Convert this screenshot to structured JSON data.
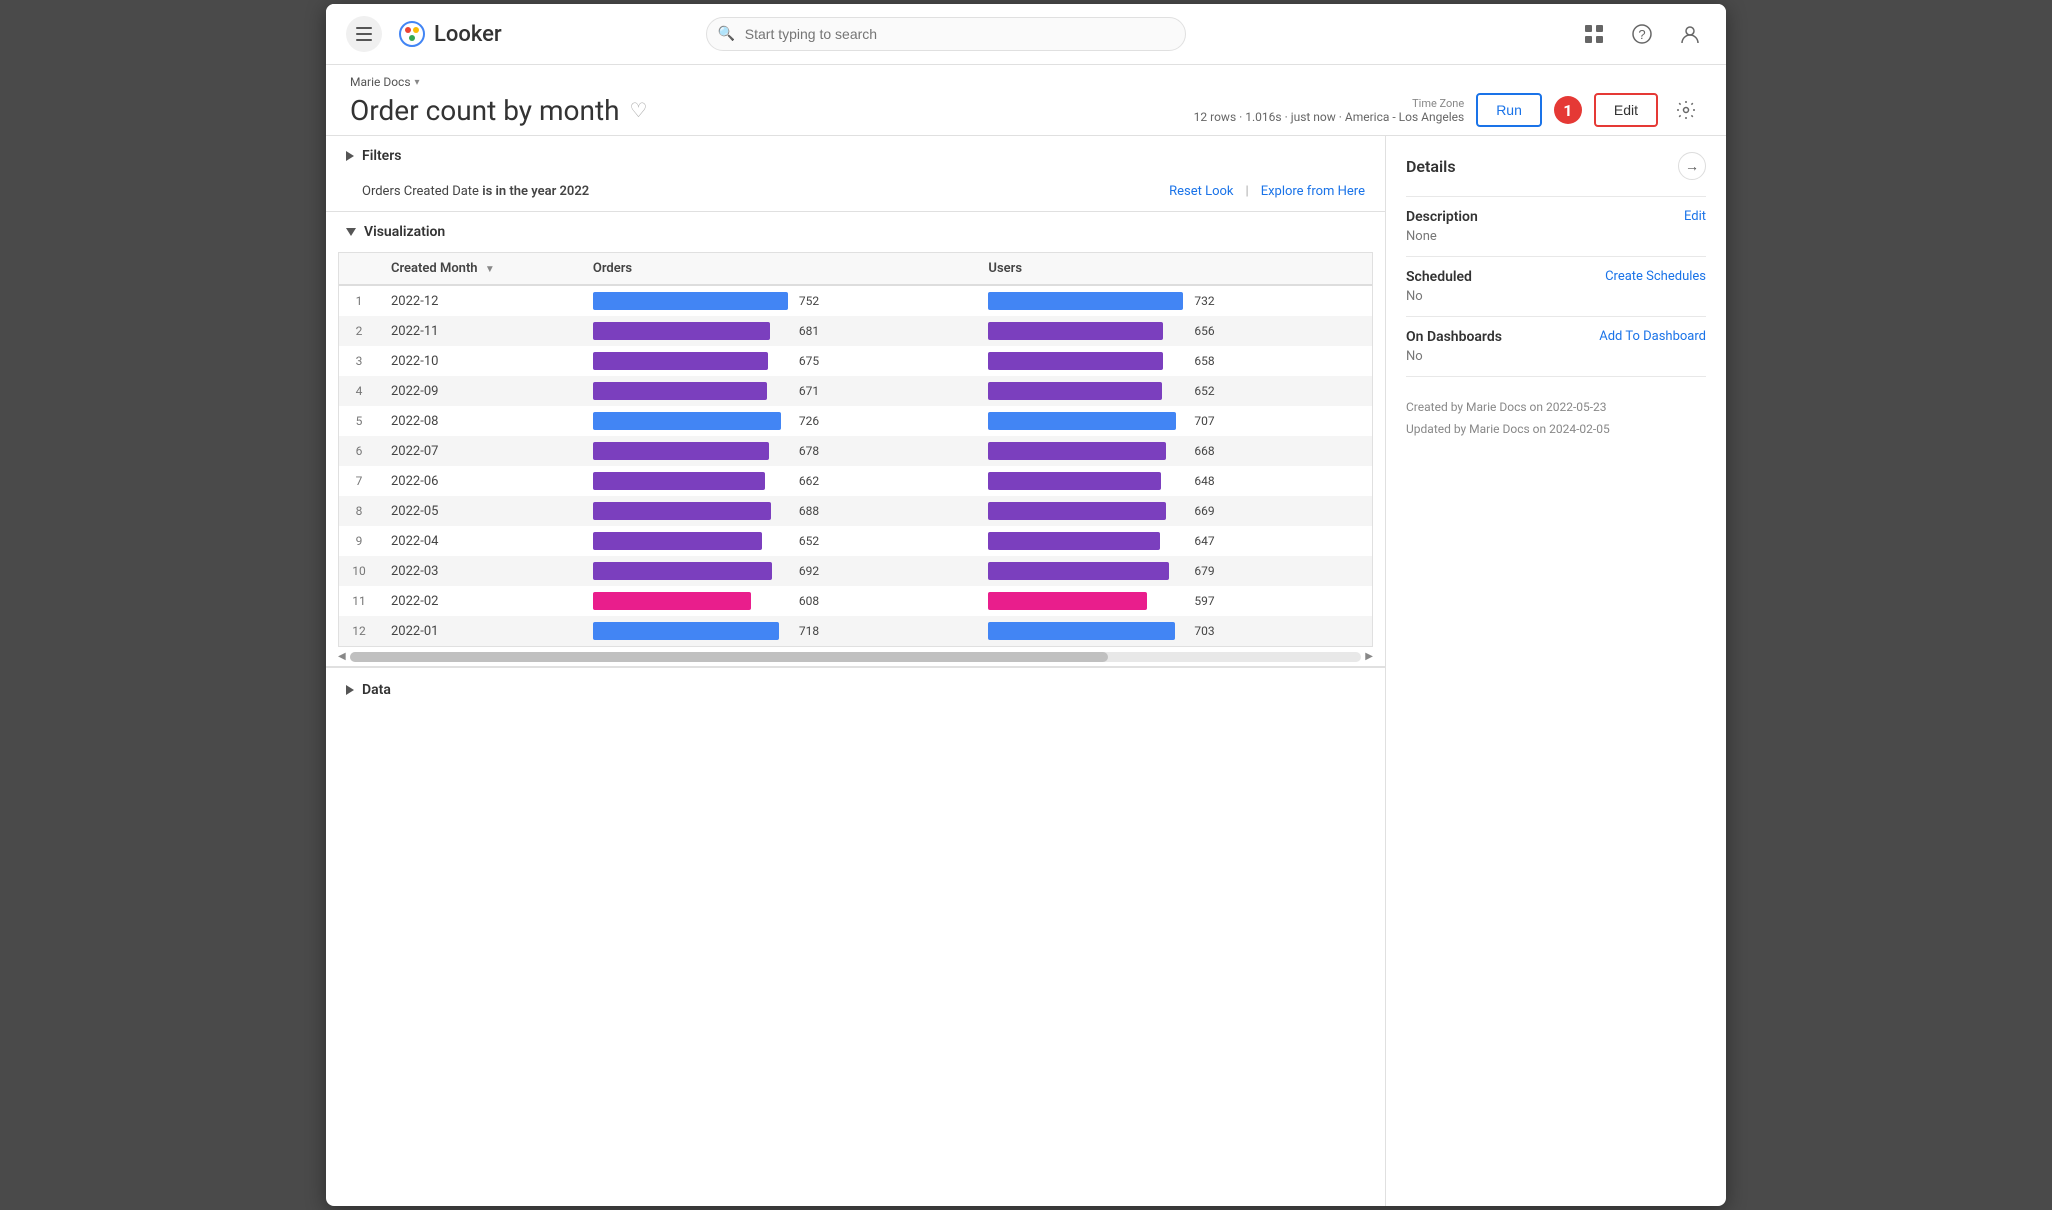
{
  "header": {
    "search_placeholder": "Start typing to search",
    "logo_text": "Looker"
  },
  "breadcrumb": {
    "label": "Marie Docs",
    "arrow": "▾"
  },
  "page": {
    "title": "Order count by month",
    "meta_rows": "12 rows",
    "meta_time": "1.016s",
    "meta_when": "just now",
    "meta_timezone_label": "Time Zone",
    "meta_timezone_value": "America - Los Angeles",
    "btn_run": "Run",
    "btn_edit": "Edit",
    "badge": "1"
  },
  "filters": {
    "label": "Filters",
    "filter_text_prefix": "Orders Created Date",
    "filter_text_bold": "is in the year 2022",
    "reset_look": "Reset Look",
    "explore_from_here": "Explore from Here"
  },
  "visualization": {
    "label": "Visualization",
    "col_row": "#",
    "col_created_month": "Created Month",
    "col_orders": "Orders",
    "col_users": "Users",
    "rows": [
      {
        "row": 1,
        "month": "2022-12",
        "orders": 752,
        "users": 732,
        "orders_pct": 100,
        "users_pct": 97,
        "orders_color": "#4285f4",
        "users_color": "#4285f4"
      },
      {
        "row": 2,
        "month": "2022-11",
        "orders": 681,
        "users": 656,
        "orders_pct": 90,
        "users_pct": 87,
        "orders_color": "#7b3fbe",
        "users_color": "#7b3fbe"
      },
      {
        "row": 3,
        "month": "2022-10",
        "orders": 675,
        "users": 658,
        "orders_pct": 89,
        "users_pct": 87,
        "orders_color": "#7b3fbe",
        "users_color": "#7b3fbe"
      },
      {
        "row": 4,
        "month": "2022-09",
        "orders": 671,
        "users": 652,
        "orders_pct": 89,
        "users_pct": 86,
        "orders_color": "#7b3fbe",
        "users_color": "#7b3fbe"
      },
      {
        "row": 5,
        "month": "2022-08",
        "orders": 726,
        "users": 707,
        "orders_pct": 96,
        "users_pct": 94,
        "orders_color": "#4285f4",
        "users_color": "#4285f4"
      },
      {
        "row": 6,
        "month": "2022-07",
        "orders": 678,
        "users": 668,
        "orders_pct": 90,
        "users_pct": 88,
        "orders_color": "#7b3fbe",
        "users_color": "#7b3fbe"
      },
      {
        "row": 7,
        "month": "2022-06",
        "orders": 662,
        "users": 648,
        "orders_pct": 88,
        "users_pct": 86,
        "orders_color": "#7b3fbe",
        "users_color": "#7b3fbe"
      },
      {
        "row": 8,
        "month": "2022-05",
        "orders": 688,
        "users": 669,
        "orders_pct": 91,
        "users_pct": 88,
        "orders_color": "#7b3fbe",
        "users_color": "#7b3fbe"
      },
      {
        "row": 9,
        "month": "2022-04",
        "orders": 652,
        "users": 647,
        "orders_pct": 86,
        "users_pct": 85,
        "orders_color": "#7b3fbe",
        "users_color": "#7b3fbe"
      },
      {
        "row": 10,
        "month": "2022-03",
        "orders": 692,
        "users": 679,
        "orders_pct": 92,
        "users_pct": 90,
        "orders_color": "#7b3fbe",
        "users_color": "#7b3fbe"
      },
      {
        "row": 11,
        "month": "2022-02",
        "orders": 608,
        "users": 597,
        "orders_pct": 80,
        "users_pct": 79,
        "orders_color": "#e91e8c",
        "users_color": "#e91e8c"
      },
      {
        "row": 12,
        "month": "2022-01",
        "orders": 718,
        "users": 703,
        "orders_pct": 95,
        "users_pct": 93,
        "orders_color": "#4285f4",
        "users_color": "#4285f4"
      }
    ]
  },
  "details": {
    "title": "Details",
    "description_label": "Description",
    "description_value": "None",
    "description_edit": "Edit",
    "scheduled_label": "Scheduled",
    "scheduled_value": "No",
    "scheduled_link": "Create Schedules",
    "on_dashboards_label": "On Dashboards",
    "on_dashboards_value": "No",
    "on_dashboards_link": "Add To Dashboard",
    "created_info_line1": "Created by Marie Docs on 2022-05-23",
    "created_info_line2": "Updated by Marie Docs on 2024-02-05"
  },
  "data_section": {
    "label": "Data"
  }
}
